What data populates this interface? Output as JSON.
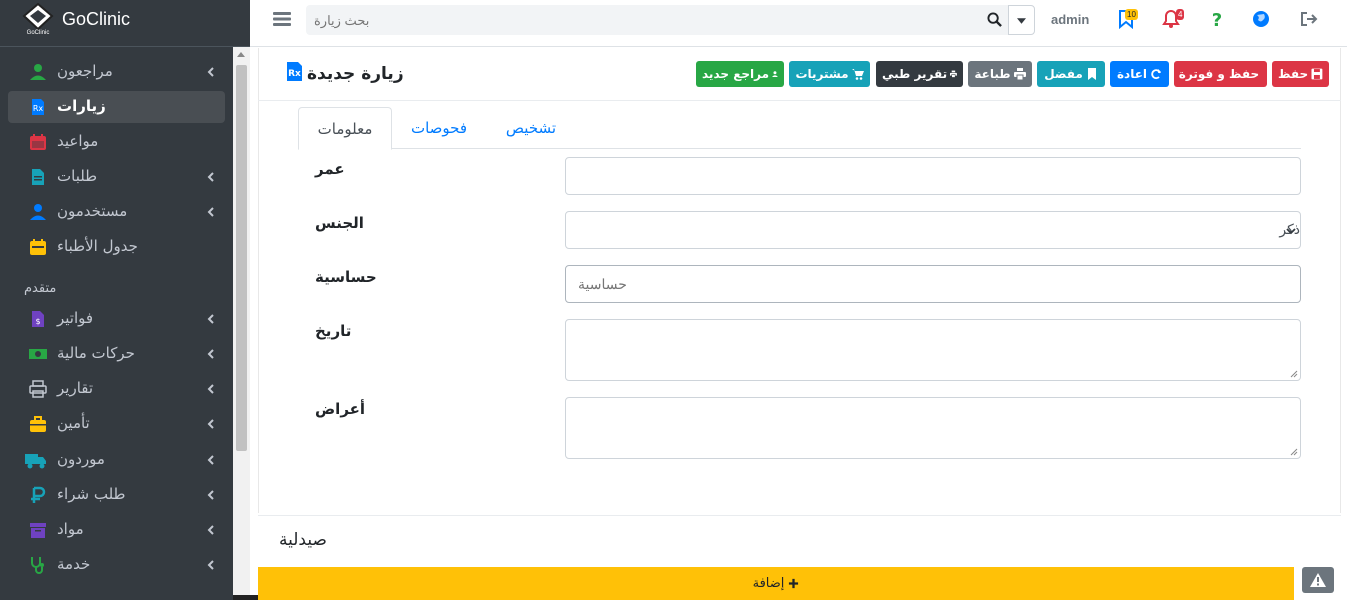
{
  "brand": {
    "name": "GoClinic",
    "logo_text": "GoClinic"
  },
  "sidebar": {
    "items": [
      {
        "label": "مراجعون",
        "icon": "user-icon",
        "color": "#28a745",
        "has_chevron": true
      },
      {
        "label": "زيارات",
        "icon": "prescription-icon",
        "color": "#007bff",
        "has_chevron": false,
        "active": true
      },
      {
        "label": "مواعيد",
        "icon": "calendar-icon",
        "color": "#dc3545",
        "has_chevron": false
      },
      {
        "label": "طلبات",
        "icon": "file-icon",
        "color": "#17a2b8",
        "has_chevron": true
      },
      {
        "label": "مستخدمون",
        "icon": "users-icon",
        "color": "#007bff",
        "has_chevron": true
      },
      {
        "label": "جدول الأطباء",
        "icon": "schedule-icon",
        "color": "#ffc107",
        "has_chevron": false
      }
    ],
    "section_header": "متقدم",
    "advanced_items": [
      {
        "label": "فواتير",
        "icon": "invoice-icon",
        "color": "#6f42c1",
        "has_chevron": true
      },
      {
        "label": "حركات مالية",
        "icon": "money-icon",
        "color": "#28a745",
        "has_chevron": true
      },
      {
        "label": "تقارير",
        "icon": "print-icon",
        "color": "#c2c7d0",
        "has_chevron": true
      },
      {
        "label": "تأمين",
        "icon": "briefcase-icon",
        "color": "#ffc107",
        "has_chevron": true
      },
      {
        "label": "موردون",
        "icon": "truck-icon",
        "color": "#17a2b8",
        "has_chevron": true
      },
      {
        "label": "طلب شراء",
        "icon": "ruble-icon",
        "color": "#17a2b8",
        "has_chevron": true
      },
      {
        "label": "مواد",
        "icon": "archive-icon",
        "color": "#6f42c1",
        "has_chevron": true
      },
      {
        "label": "خدمة",
        "icon": "stethoscope-icon",
        "color": "#28a745",
        "has_chevron": true
      }
    ]
  },
  "topbar": {
    "search_placeholder": "بحث زيارة",
    "user": "admin",
    "bookmark_badge": "10",
    "notification_badge": "4"
  },
  "page": {
    "title": "زيارة جديدة"
  },
  "toolbar": {
    "save": "حفظ",
    "save_invoice": "حفظ و فوترة",
    "reload": "اعادة",
    "favorite": "مفضل",
    "print": "طباعة",
    "medical_report": "تقرير طبي",
    "purchases": "مشتريات",
    "new_patient": "مراجع جديد"
  },
  "tabs": {
    "info": "معلومات",
    "tests": "فحوصات",
    "diagnosis": "تشخيص"
  },
  "form": {
    "age_label": "عمر",
    "age_value": "",
    "gender_label": "الجنس",
    "gender_value": "ذكر",
    "allergy_label": "حساسية",
    "allergy_placeholder": "حساسية",
    "history_label": "تاريخ",
    "symptoms_label": "أعراض"
  },
  "pharmacy": {
    "title": "صيدلية",
    "add_label": "إضافة"
  },
  "colors": {
    "sidebar_bg": "#343a40",
    "danger": "#dc3545",
    "primary": "#007bff",
    "info": "#17a2b8",
    "secondary": "#6c757d",
    "dark": "#343a40",
    "success": "#28a745",
    "warning": "#ffc107"
  }
}
